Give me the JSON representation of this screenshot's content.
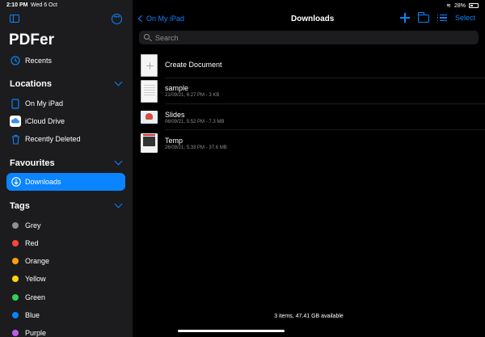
{
  "status": {
    "time": "2:10 PM",
    "date": "Wed 6 Oct",
    "battery": "28%"
  },
  "sidebar": {
    "app_title": "PDFer",
    "recents_label": "Recents",
    "locations_header": "Locations",
    "locations": [
      {
        "label": "On My iPad",
        "icon": "ipad-icon"
      },
      {
        "label": "iCloud Drive",
        "icon": "icloud-icon"
      },
      {
        "label": "Recently Deleted",
        "icon": "trash-icon"
      }
    ],
    "favourites_header": "Favourites",
    "favourites": [
      {
        "label": "Downloads",
        "icon": "download-icon"
      }
    ],
    "tags_header": "Tags",
    "tags": [
      {
        "label": "Grey",
        "color": "#8e8e93"
      },
      {
        "label": "Red",
        "color": "#ff453a"
      },
      {
        "label": "Orange",
        "color": "#ff9f0a"
      },
      {
        "label": "Yellow",
        "color": "#ffd60a"
      },
      {
        "label": "Green",
        "color": "#30d158"
      },
      {
        "label": "Blue",
        "color": "#0a84ff"
      },
      {
        "label": "Purple",
        "color": "#bf5af2"
      }
    ]
  },
  "navbar": {
    "back_label": "On My iPad",
    "title": "Downloads",
    "select_label": "Select"
  },
  "search": {
    "placeholder": "Search"
  },
  "files": [
    {
      "name": "Create Document",
      "meta": ""
    },
    {
      "name": "sample",
      "meta": "21/09/21, 6:27 PM - 3 KB"
    },
    {
      "name": "Slides",
      "meta": "06/09/21, 5:52 PM - 7.3 MB"
    },
    {
      "name": "Temp",
      "meta": "26/09/21, 5:33 PM - 37.6 MB"
    }
  ],
  "footer": {
    "summary": "3 items, 47.41 GB available"
  },
  "colors": {
    "accent": "#0a84ff",
    "sidebar_bg": "#1c1c1e",
    "content_bg": "#000000"
  }
}
